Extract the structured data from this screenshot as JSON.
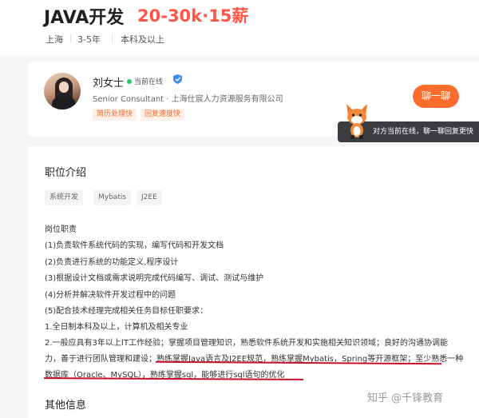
{
  "job": {
    "title": "JAVA开发",
    "salary": "20-30k·15薪",
    "location": "上海",
    "experience": "3-5年",
    "education": "本科及以上"
  },
  "recruiter": {
    "name": "刘女士",
    "status": "当前在线",
    "title": "Senior Consultant · 上海仕宸人力资源服务有限公司",
    "tags": [
      "简历处理快",
      "回复速度快"
    ],
    "chat_label": "聊一聊",
    "tooltip": "对方当前在线，聊一聊回复更快"
  },
  "description": {
    "section_title": "职位介绍",
    "skills": [
      "系统开发",
      "Mybatis",
      "J2EE"
    ],
    "lines": [
      "岗位职责",
      "(1)负责软件系统代码的实现，编写代码和开发文档",
      "(2)负责进行系统的功能定义,程序设计",
      "(3)根据设计文档或需求说明完成代码编写、调试、测试与维护",
      "(4)分析并解决软件开发过程中的问题",
      "(5)配合技术经理完成相关任务目标任职要求：",
      "1.全日制本科及以上，计算机及相关专业",
      "2.一般应具有3年以上IT工作经验；掌握项目管理知识，熟悉软件系统开发和实施相关知识领域；良好的沟通协调能",
      "力，善于进行团队管理和建设；熟练掌握Java语言及J2EE规范，熟练掌握Mybatis，Spring等开源框架；至少熟悉一种",
      "数据库（Oracle、MySQL），熟练掌握sql，能够进行sql语句的优化"
    ],
    "other_title": "其他信息"
  },
  "watermark": "知乎 @千锋教育",
  "colors": {
    "salary": "#fe574a",
    "chat_button": "#fe6d2c",
    "online": "#26c96b",
    "underline": "#c8102e"
  }
}
